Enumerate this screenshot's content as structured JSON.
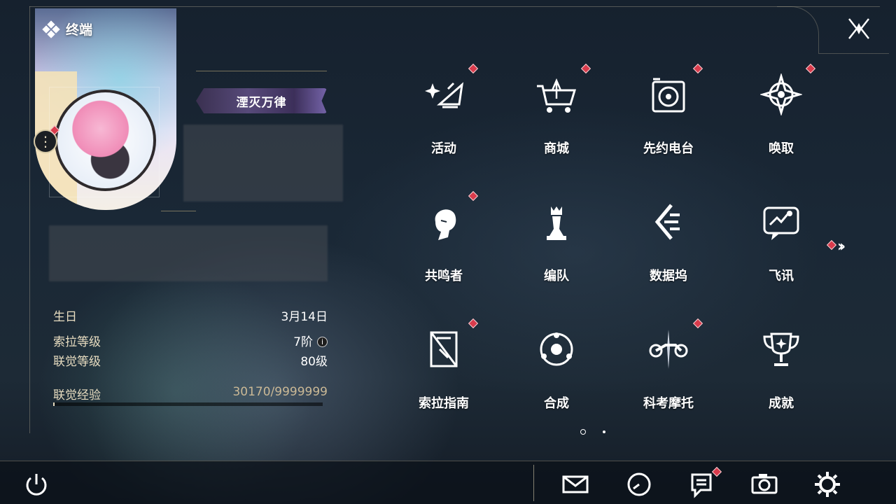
{
  "app": {
    "title": "终端"
  },
  "profile": {
    "title_tag": "湮灭万律",
    "stats": [
      {
        "label": "生日",
        "value": "3月14日"
      },
      {
        "label": "索拉等级",
        "value": "7阶"
      },
      {
        "label": "联觉等级",
        "value": "80级"
      }
    ],
    "exp": {
      "label": "联觉经验",
      "value": "30170/9999999",
      "progress": 0.003
    }
  },
  "grid": {
    "items": [
      {
        "label": "活动",
        "icon": "sparkle-icon",
        "badge": true
      },
      {
        "label": "商城",
        "icon": "shopping-cart-icon",
        "badge": true
      },
      {
        "label": "先约电台",
        "icon": "radio-icon",
        "badge": true
      },
      {
        "label": "唤取",
        "icon": "compass-star-icon",
        "badge": true
      },
      {
        "label": "共鸣者",
        "icon": "character-head-icon",
        "badge": true
      },
      {
        "label": "编队",
        "icon": "chess-piece-icon",
        "badge": false
      },
      {
        "label": "数据坞",
        "icon": "data-dock-icon",
        "badge": false
      },
      {
        "label": "飞讯",
        "icon": "chat-bubble-icon",
        "badge": false
      },
      {
        "label": "索拉指南",
        "icon": "guide-book-icon",
        "badge": true
      },
      {
        "label": "合成",
        "icon": "synthesis-icon",
        "badge": false
      },
      {
        "label": "科考摩托",
        "icon": "motorcycle-icon",
        "badge": true
      },
      {
        "label": "成就",
        "icon": "trophy-icon",
        "badge": false
      }
    ],
    "page_count": 2,
    "current_page": 1
  },
  "bottom_bar": {
    "icons": [
      "power-icon",
      "mail-icon",
      "clock-icon",
      "notice-icon",
      "camera-icon",
      "settings-gear-icon"
    ]
  },
  "colors": {
    "badge": "#d93b4c",
    "accent_gold": "#e7dcc0"
  }
}
